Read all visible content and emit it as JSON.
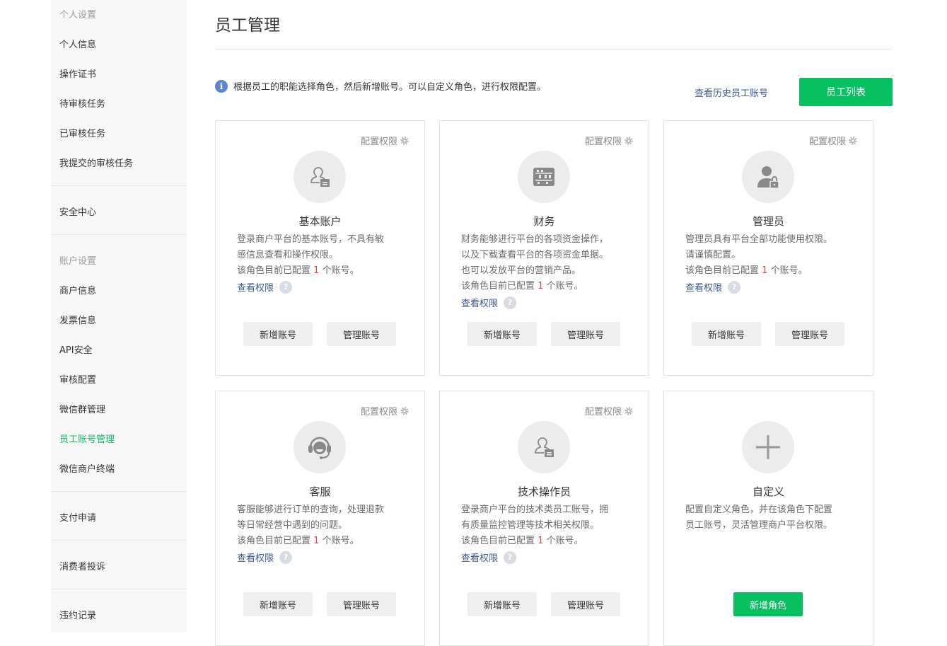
{
  "sidebar": {
    "personal_title": "个人设置",
    "personal_items": [
      "个人信息",
      "操作证书",
      "待审核任务",
      "已审核任务",
      "我提交的审核任务"
    ],
    "security": "安全中心",
    "account_title": "账户设置",
    "account_items": [
      "商户信息",
      "发票信息",
      "API安全",
      "审核配置",
      "微信群管理",
      "员工账号管理",
      "微信商户终端"
    ],
    "payment": "支付申请",
    "complaints": "消费者投诉",
    "violations": "违约记录"
  },
  "header": {
    "title": "员工管理",
    "tip_icon": "i",
    "tip": "根据员工的职能选择角色，然后新增账号。可以自定义角色，进行权限配置。",
    "history_link": "查看历史员工账号",
    "list_button": "员工列表"
  },
  "colors": {
    "accent": "#07c160",
    "link": "#3d5a8a",
    "count": "#e64340"
  },
  "common": {
    "config_perm": "配置权限",
    "view_perm": "查看权限",
    "q_icon": "?",
    "add_account": "新增账号",
    "manage_account": "管理账号",
    "count_prefix": "该角色目前已配置",
    "count_suffix": "个账号。"
  },
  "cards": [
    {
      "title": "基本账户",
      "icon": "basic-account-icon",
      "lines": [
        "登录商户平台的基本账号，不具有敏",
        "感信息查看和操作权限。"
      ],
      "count": "1"
    },
    {
      "title": "财务",
      "icon": "abacus-icon",
      "lines": [
        "财务能够进行平台的各项资金操作，",
        "以及下载查看平台的各项资金单据。",
        "也可以发放平台的营销产品。"
      ],
      "count": "1"
    },
    {
      "title": "管理员",
      "icon": "admin-lock-icon",
      "lines": [
        "管理员具有平台全部功能使用权限。",
        "请谨慎配置。"
      ],
      "count": "1"
    },
    {
      "title": "客服",
      "icon": "headset-icon",
      "lines": [
        "客服能够进行订单的查询，处理退款",
        "等日常经营中遇到的问题。"
      ],
      "count": "1"
    },
    {
      "title": "技术操作员",
      "icon": "tech-operator-icon",
      "lines": [
        "登录商户平台的技术类员工账号，拥",
        "有质量监控管理等技术相关权限。"
      ],
      "count": "1"
    },
    {
      "title": "自定义",
      "icon": "plus-icon",
      "lines": [
        "配置自定义角色，并在该角色下配置",
        "员工账号，灵活管理商户平台权限。"
      ],
      "button": "新增角色"
    }
  ]
}
